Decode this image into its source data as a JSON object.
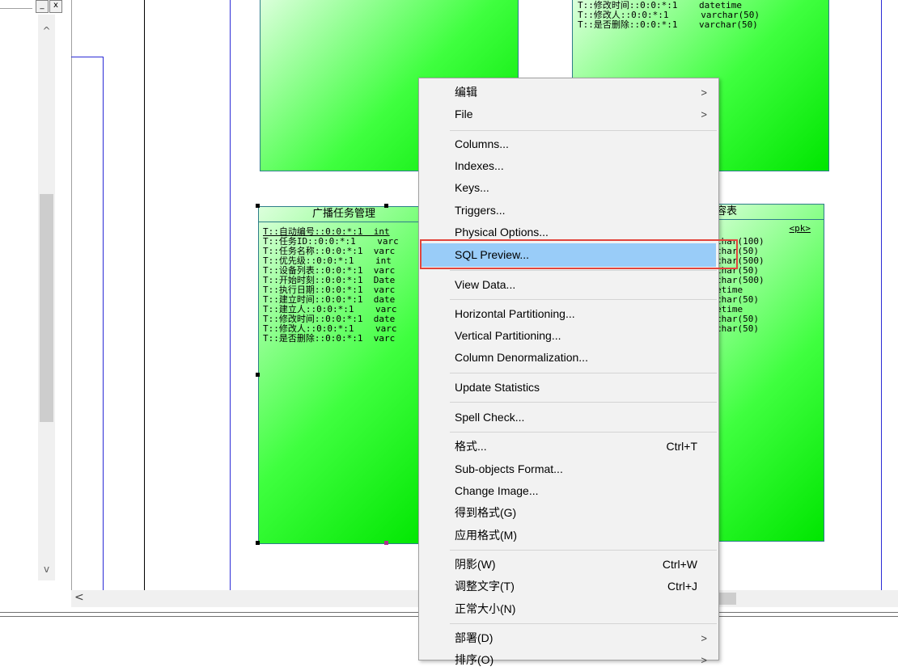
{
  "left_panel": {
    "scroll_up": "^",
    "scroll_down": "v",
    "buttons": [
      "_",
      "x"
    ]
  },
  "canvas": {
    "scroll_left": "<",
    "entity_top_right": {
      "rows": [
        "T::修改时间::0:0:*:1    datetime",
        "T::修改人::0:0:*:1      varchar(50)",
        "T::是否删除::0:0:*:1    varchar(50)"
      ]
    },
    "entity_main": {
      "title": "广播任务管理",
      "rows": [
        "T::自动编号::0:0:*:1  int",
        "T::任务ID::0:0:*:1    varc",
        "T::任务名称::0:0:*:1  varc",
        "T::优先级::0:0:*:1    int",
        "T::设备列表::0:0:*:1  varc",
        "T::开始时刻::0:0:*:1  Date",
        "T::执行日期::0:0:*:1  varc",
        "T::建立时间::0:0:*:1  date",
        "T::建立人::0:0:*:1    varc",
        "T::修改时间::0:0:*:1  date",
        "T::修改人::0:0:*:1    varc",
        "T::是否删除::0:0:*:1  varc"
      ]
    },
    "entity_right": {
      "title": "容表",
      "pk": "<pk>",
      "rows": [
        "char(100)",
        "",
        "char(50)",
        "",
        "char(500)",
        "char(50)",
        "char(500)",
        "etime",
        "char(50)",
        "etime",
        "char(50)",
        "char(50)"
      ]
    }
  },
  "context_menu": {
    "items": [
      {
        "label": "编辑",
        "arrow": ">"
      },
      {
        "label": "File",
        "arrow": ">"
      },
      {
        "label": "Columns..."
      },
      {
        "label": "Indexes..."
      },
      {
        "label": "Keys..."
      },
      {
        "label": "Triggers..."
      },
      {
        "label": "Physical Options..."
      },
      {
        "label": "SQL Preview...",
        "highlighted": true
      },
      {
        "label": "View Data..."
      },
      {
        "label": "Horizontal Partitioning..."
      },
      {
        "label": "Vertical Partitioning..."
      },
      {
        "label": "Column Denormalization..."
      },
      {
        "label": "Update Statistics"
      },
      {
        "label": "Spell Check..."
      },
      {
        "label": "格式...",
        "shortcut": "Ctrl+T"
      },
      {
        "label": "Sub-objects Format..."
      },
      {
        "label": "Change Image..."
      },
      {
        "label": "得到格式(G)"
      },
      {
        "label": "应用格式(M)"
      },
      {
        "label": "阴影(W)",
        "shortcut": "Ctrl+W"
      },
      {
        "label": "调整文字(T)",
        "shortcut": "Ctrl+J"
      },
      {
        "label": "正常大小(N)"
      },
      {
        "label": "部署(D)",
        "arrow": ">"
      },
      {
        "label": "排序(O)",
        "arrow": ">"
      }
    ]
  },
  "colors": {
    "highlight": "#99ccf8",
    "annotation": "#e2453c",
    "entity_green": "#00e600"
  }
}
